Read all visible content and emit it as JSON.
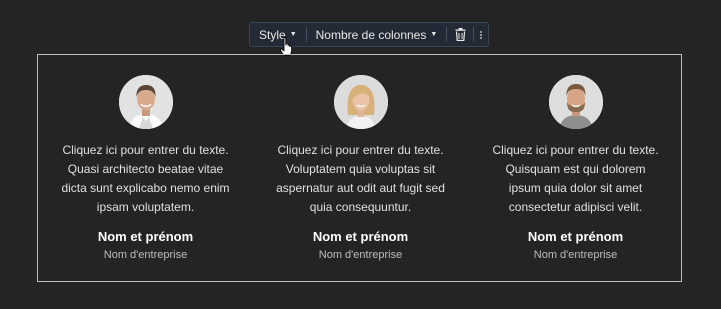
{
  "toolbar": {
    "style_label": "Style",
    "columns_label": "Nombre de colonnes",
    "delete_icon": "trash-icon",
    "more_icon": "more-vertical-icon"
  },
  "columns": [
    {
      "avatar": "man-portrait",
      "text": "Cliquez ici pour entrer du texte. Quasi architecto beatae vitae dicta sunt explicabo nemo enim ipsam voluptatem.",
      "name": "Nom et prénom",
      "company": "Nom d'entreprise"
    },
    {
      "avatar": "woman-portrait",
      "text": "Cliquez ici pour entrer du texte. Voluptatem quia voluptas sit aspernatur aut odit aut fugit sed quia consequuntur.",
      "name": "Nom et prénom",
      "company": "Nom d'entreprise"
    },
    {
      "avatar": "bearded-man-portrait",
      "text": "Cliquez ici pour entrer du texte. Quisquam est qui dolorem ipsum quia dolor sit amet consectetur adipisci velit.",
      "name": "Nom et prénom",
      "company": "Nom d'entreprise"
    }
  ],
  "colors": {
    "background": "#242424",
    "toolbar_bg": "#232a36",
    "block_border": "#bdbdbd"
  }
}
